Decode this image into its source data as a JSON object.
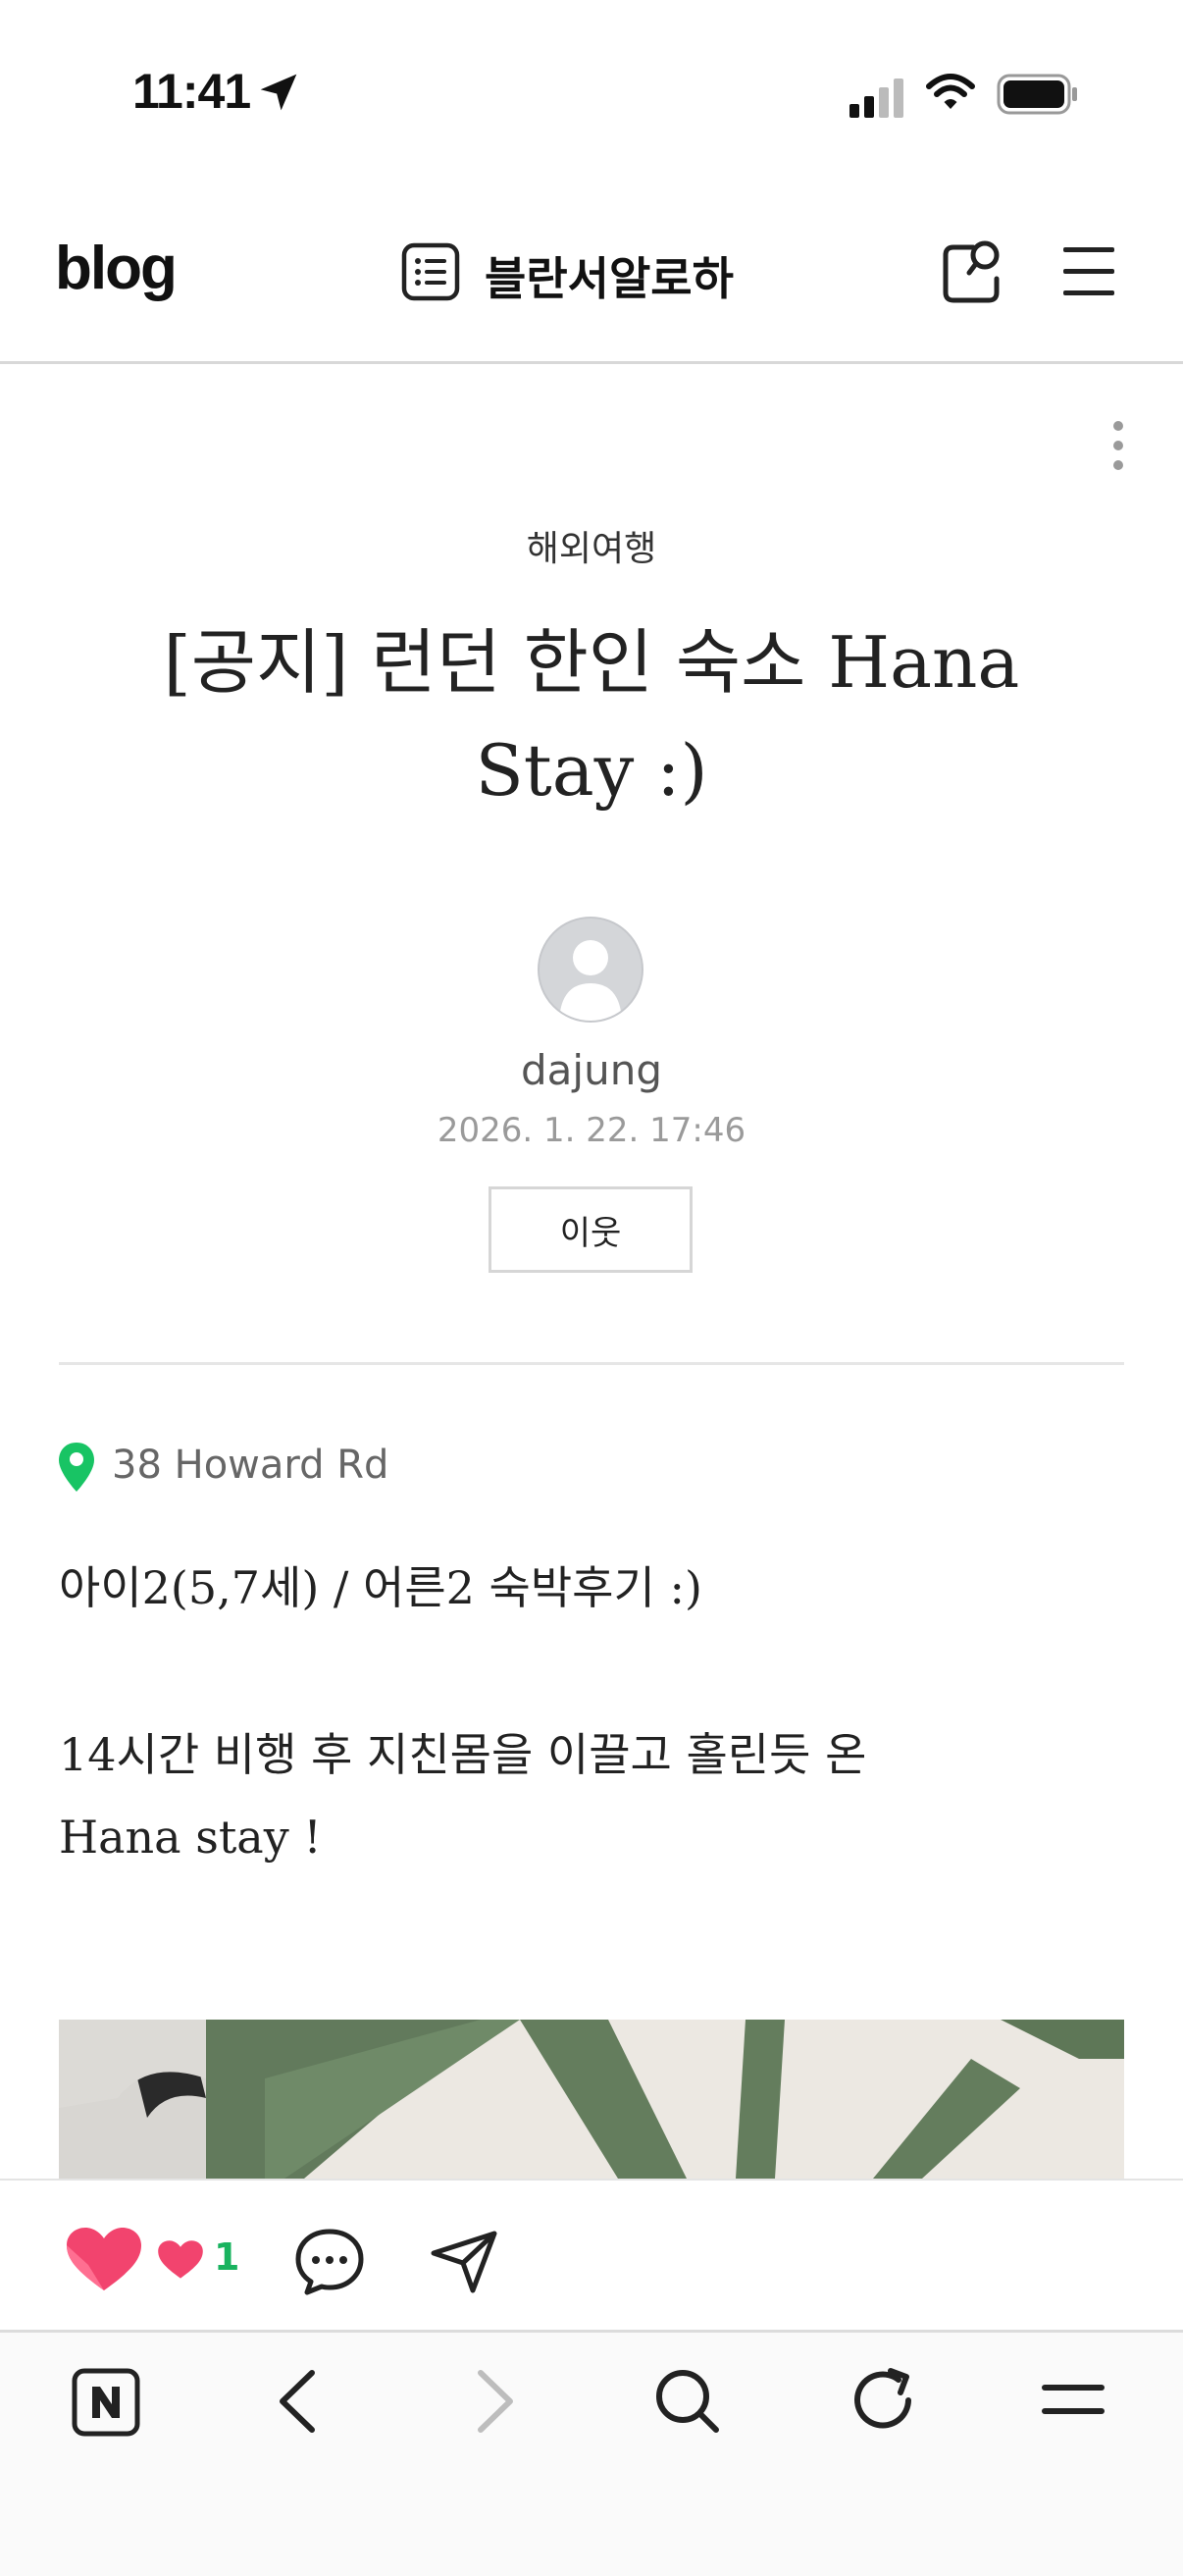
{
  "status_bar": {
    "time": "11:41",
    "icons": [
      "location-arrow-icon",
      "cellular-signal-icon",
      "wifi-icon",
      "battery-icon"
    ]
  },
  "header": {
    "logo": "blog",
    "blog_name": "블란서알로하",
    "icons": [
      "category-list-icon",
      "my-news-search-icon",
      "hamburger-menu-icon"
    ]
  },
  "post": {
    "category": "해외여행",
    "title_line1": "[공지] 런던 한인 숙소 Hana",
    "title_line2": "Stay :)",
    "author": "dajung",
    "date": "2026. 1. 22. 17:46",
    "neighbor_button": "이웃",
    "location": "38 Howard Rd",
    "paragraph1": "아이2(5,7세) / 어른2 숙박후기 :)",
    "paragraph2_line1": "14시간 비행 후 지친몸을 이끌고 홀린듯 온",
    "paragraph2_line2": "Hana stay !"
  },
  "action_bar": {
    "like_count": "1",
    "icons": [
      "like-heart-icon",
      "sympathy-heart-icon",
      "comment-icon",
      "share-icon"
    ]
  },
  "browser_bar": {
    "icons": [
      "naver-home-icon",
      "back-arrow-icon",
      "forward-arrow-icon",
      "search-icon",
      "reload-icon",
      "menu-icon"
    ]
  },
  "colors": {
    "accent_green": "#19b35f",
    "heart_pink": "#f2446e",
    "divider": "#e6e6e6"
  }
}
